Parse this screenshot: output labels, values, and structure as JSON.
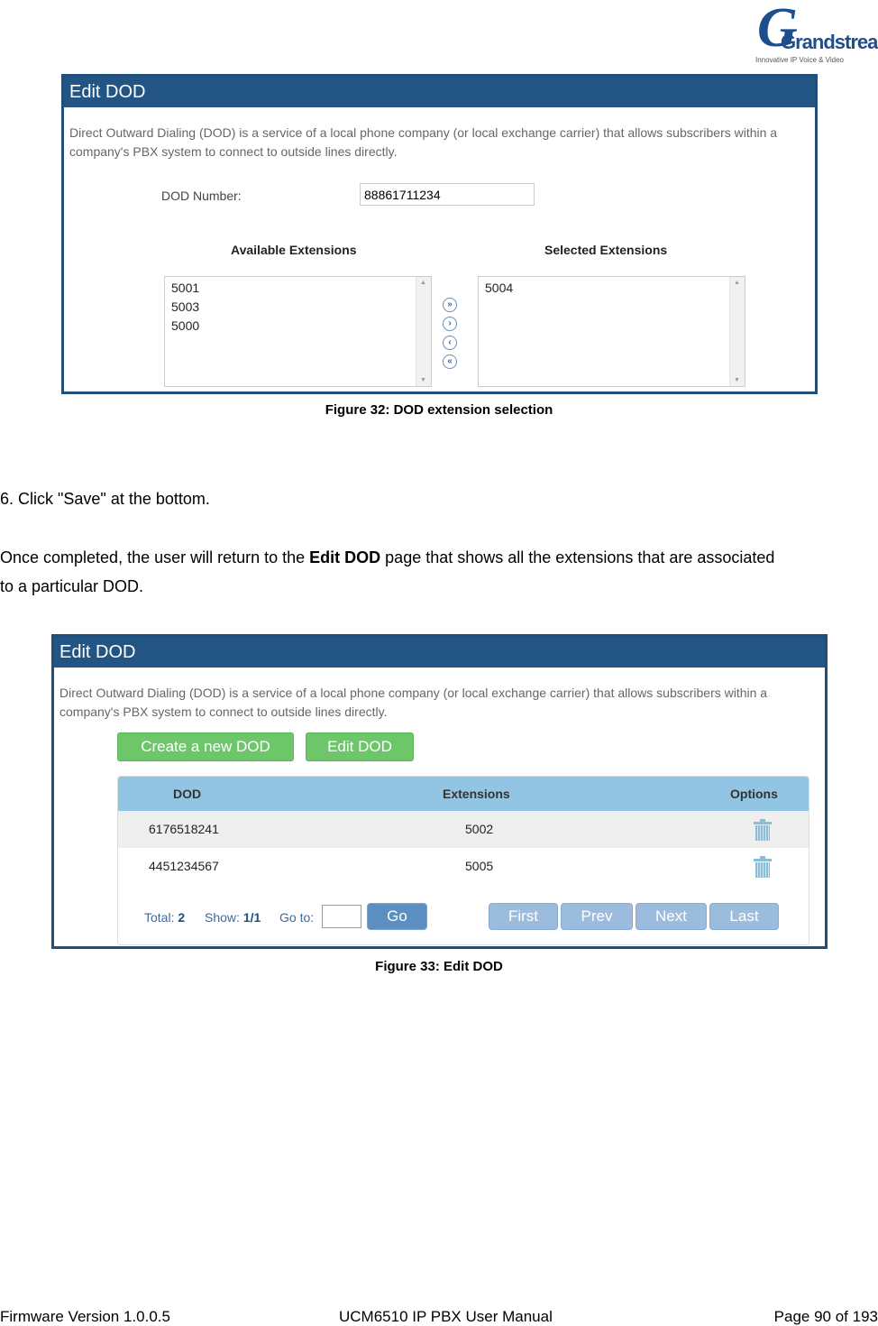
{
  "logo": {
    "brand": "Grandstream",
    "tagline": "Innovative IP Voice & Video"
  },
  "figure32": {
    "title": "Edit DOD",
    "description_line1": "Direct Outward Dialing (DOD) is a service of a local phone company (or local exchange carrier) that allows subscribers within a",
    "description_line2": "company's PBX system to connect to outside lines directly.",
    "dod_number_label": "DOD Number:",
    "dod_number_value": "88861711234",
    "available_header": "Available Extensions",
    "selected_header": "Selected Extensions",
    "available": [
      "5001",
      "5003",
      "5000"
    ],
    "selected": [
      "5004"
    ],
    "arrow_icons": [
      "move-all-right-icon",
      "move-right-icon",
      "move-left-icon",
      "move-all-left-icon"
    ],
    "caption": "Figure 32: DOD extension selection"
  },
  "step6": "6.    Click \"Save\" at the bottom.",
  "para": {
    "before": "Once completed, the user will return to the ",
    "bold": "Edit DOD",
    "after": " page that shows all the extensions that are associated",
    "line2": "to a particular DOD."
  },
  "figure33": {
    "title": "Edit DOD",
    "description_line1": "Direct Outward Dialing (DOD) is a service of a local phone company (or local exchange carrier) that allows subscribers within a",
    "description_line2": "company's PBX system to connect to outside lines directly.",
    "create_button": "Create a new DOD",
    "edit_button": "Edit DOD",
    "columns": [
      "DOD",
      "Extensions",
      "Options"
    ],
    "rows": [
      {
        "dod": "6176518241",
        "extensions": "5002"
      },
      {
        "dod": "4451234567",
        "extensions": "5005"
      }
    ],
    "pager": {
      "total_label": "Total:",
      "total": "2",
      "show_label": "Show:",
      "show": "1/1",
      "goto_label": "Go to:",
      "goto_value": "",
      "go": "Go",
      "first": "First",
      "prev": "Prev",
      "next": "Next",
      "last": "Last"
    },
    "caption": "Figure 33: Edit DOD"
  },
  "footer": {
    "left": "Firmware Version 1.0.0.5",
    "center": "UCM6510 IP PBX User Manual",
    "right": "Page 90 of 193"
  }
}
